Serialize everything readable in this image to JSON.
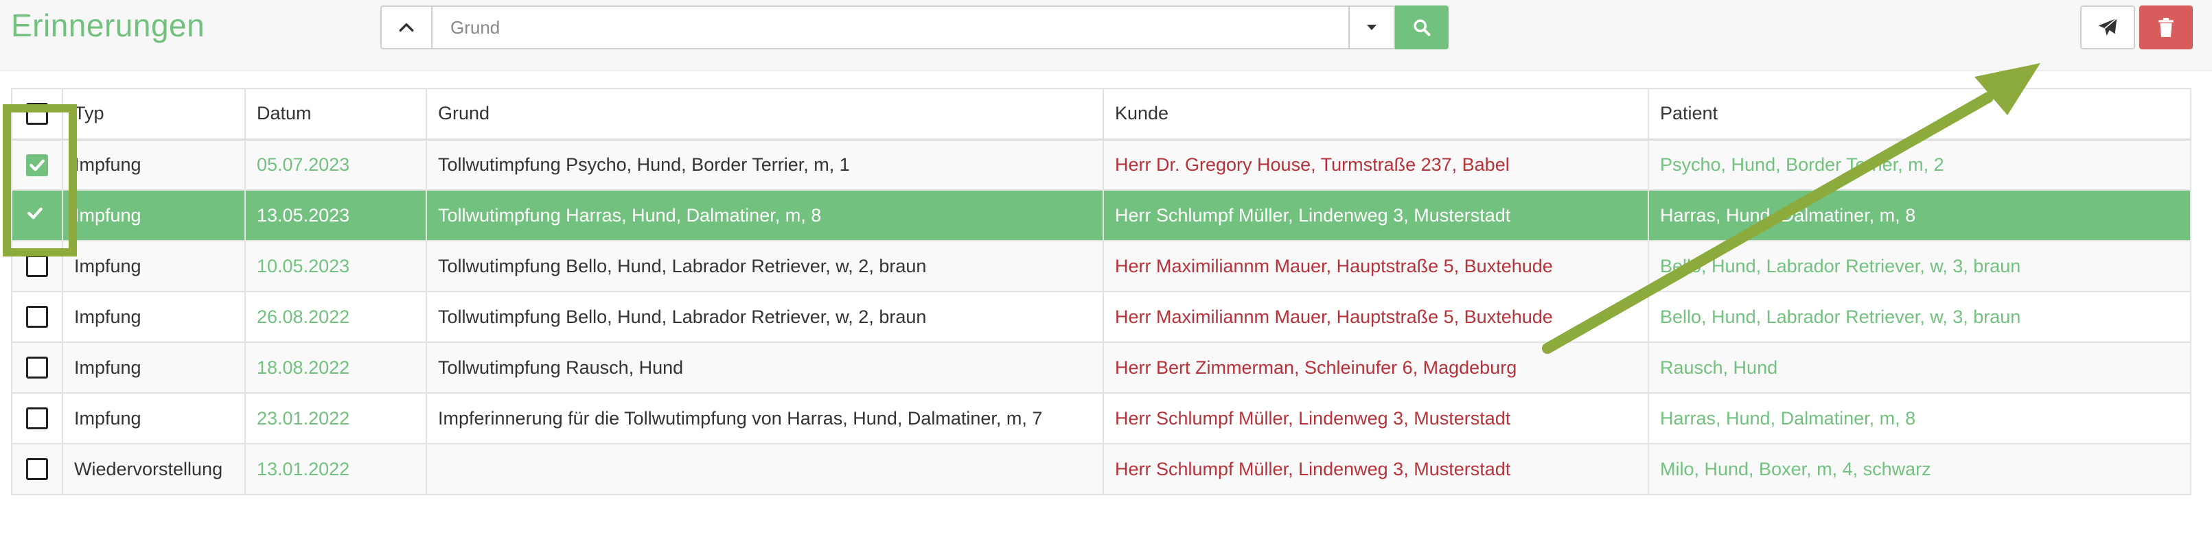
{
  "page": {
    "title": "Erinnerungen"
  },
  "search": {
    "placeholder": "Grund",
    "value": ""
  },
  "colors": {
    "accent": "#72c17f",
    "customer_text": "#b8323a",
    "delete_button": "#d95c5c",
    "annotation": "#8cab3c"
  },
  "icons": {
    "collapse": "chevron-up-icon",
    "dropdown": "caret-down-icon",
    "search": "search-icon",
    "send": "paper-plane-icon",
    "delete": "trash-icon"
  },
  "table": {
    "headers": {
      "typ": "Typ",
      "datum": "Datum",
      "grund": "Grund",
      "kunde": "Kunde",
      "patient": "Patient"
    },
    "rows": [
      {
        "typ": "Impfung",
        "datum": "05.07.2023",
        "grund": "Tollwutimpfung Psycho, Hund, Border Terrier, m, 1",
        "kunde": "Herr Dr. Gregory House, Turmstraße 237, Babel",
        "patient": "Psycho, Hund, Border Terrier, m, 2",
        "checked": true,
        "selected": false
      },
      {
        "typ": "Impfung",
        "datum": "13.05.2023",
        "grund": "Tollwutimpfung Harras, Hund, Dalmatiner, m, 8",
        "kunde": "Herr Schlumpf Müller, Lindenweg 3, Musterstadt",
        "patient": "Harras, Hund, Dalmatiner, m, 8",
        "checked": true,
        "selected": true
      },
      {
        "typ": "Impfung",
        "datum": "10.05.2023",
        "grund": "Tollwutimpfung Bello, Hund, Labrador Retriever, w, 2, braun",
        "kunde": "Herr Maximiliannm Mauer, Hauptstraße 5, Buxtehude",
        "patient": "Bello, Hund, Labrador Retriever, w, 3, braun",
        "checked": false,
        "selected": false
      },
      {
        "typ": "Impfung",
        "datum": "26.08.2022",
        "grund": "Tollwutimpfung Bello, Hund, Labrador Retriever, w, 2, braun",
        "kunde": "Herr Maximiliannm Mauer, Hauptstraße 5, Buxtehude",
        "patient": "Bello, Hund, Labrador Retriever, w, 3, braun",
        "checked": false,
        "selected": false
      },
      {
        "typ": "Impfung",
        "datum": "18.08.2022",
        "grund": "Tollwutimpfung Rausch, Hund",
        "kunde": "Herr Bert Zimmerman, Schleinufer 6, Magdeburg",
        "patient": "Rausch, Hund",
        "checked": false,
        "selected": false
      },
      {
        "typ": "Impfung",
        "datum": "23.01.2022",
        "grund": "Impferinnerung für die Tollwutimpfung von Harras, Hund, Dalmatiner, m, 7",
        "kunde": "Herr Schlumpf Müller, Lindenweg 3, Musterstadt",
        "patient": "Harras, Hund, Dalmatiner, m, 8",
        "checked": false,
        "selected": false
      },
      {
        "typ": "Wiedervorstellung",
        "datum": "13.01.2022",
        "grund": "",
        "kunde": "Herr Schlumpf Müller, Lindenweg 3, Musterstadt",
        "patient": "Milo, Hund, Boxer, m, 4, schwarz",
        "checked": false,
        "selected": false
      }
    ]
  }
}
